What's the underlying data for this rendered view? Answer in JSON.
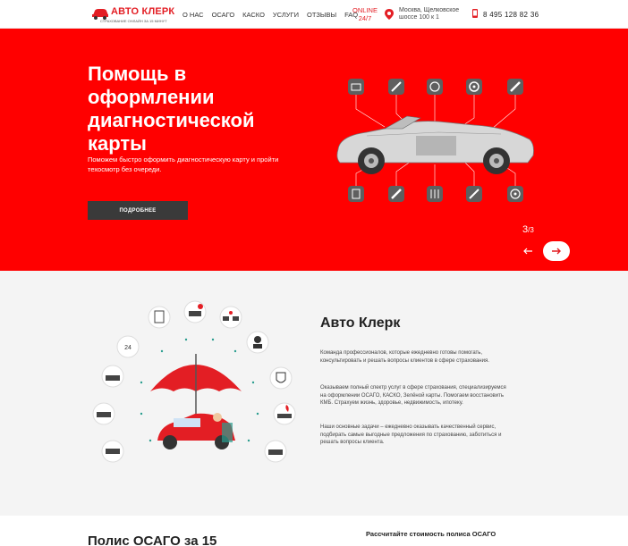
{
  "header": {
    "logo_title": "АВТО КЛЕРК",
    "logo_subtitle": "СТРАХОВАНИЕ ОНЛАЙН ЗА 15 МИНУТ",
    "nav": [
      "О НАС",
      "ОСАГО",
      "КАСКО",
      "УСЛУГИ",
      "ОТЗЫВЫ",
      "FAQ"
    ],
    "online_line1": "ONLINE",
    "online_line2": "24/7",
    "address_line1": "Москва, Щелковское",
    "address_line2": "шоссе 100 к 1",
    "phone": "8 495 128 82 36"
  },
  "hero": {
    "title": "Помощь в оформлении диагностической карты",
    "text": "Поможем быстро оформить диагностическую карту и пройти техосмотр без очереди.",
    "button": "ПОДРОБНЕЕ",
    "slide_current": "3",
    "slide_total": "/3",
    "top_icons": [
      "toolbox-icon",
      "wrench-icon",
      "steering-wheel-icon",
      "wheel-icon",
      "spark-plug-icon"
    ],
    "bottom_icons": [
      "oil-filter-icon",
      "spark-plug-icon",
      "shock-absorber-icon",
      "spray-icon",
      "brake-disc-icon"
    ]
  },
  "about": {
    "title": "Авто Клерк",
    "p1": "Команда профессионалов, которые ежедневно готовы помогать, консультировать и решать вопросы клиентов в сфере страхования.",
    "p2": "Оказываем полный спектр услуг в сфере страхования, специализируемся на оформлении ОСАГО, КАСКО, Зелёной карты. Помогаем восстановить КМБ. Страхуем жизнь, здоровье, недвижимость, ипотеку.",
    "p3": "Наши основные задачи – ежедневно оказывать качественный сервис, подбирать самые выгодные предложения по страхованию, заботиться и решать вопросы клиента.",
    "badge_24": "24"
  },
  "bottom": {
    "title": "Полис ОСАГО за 15",
    "calc": "Рассчитайте стоимость полиса ОСАГО"
  },
  "colors": {
    "accent": "#ff0000",
    "dark": "#3a3a3a"
  }
}
